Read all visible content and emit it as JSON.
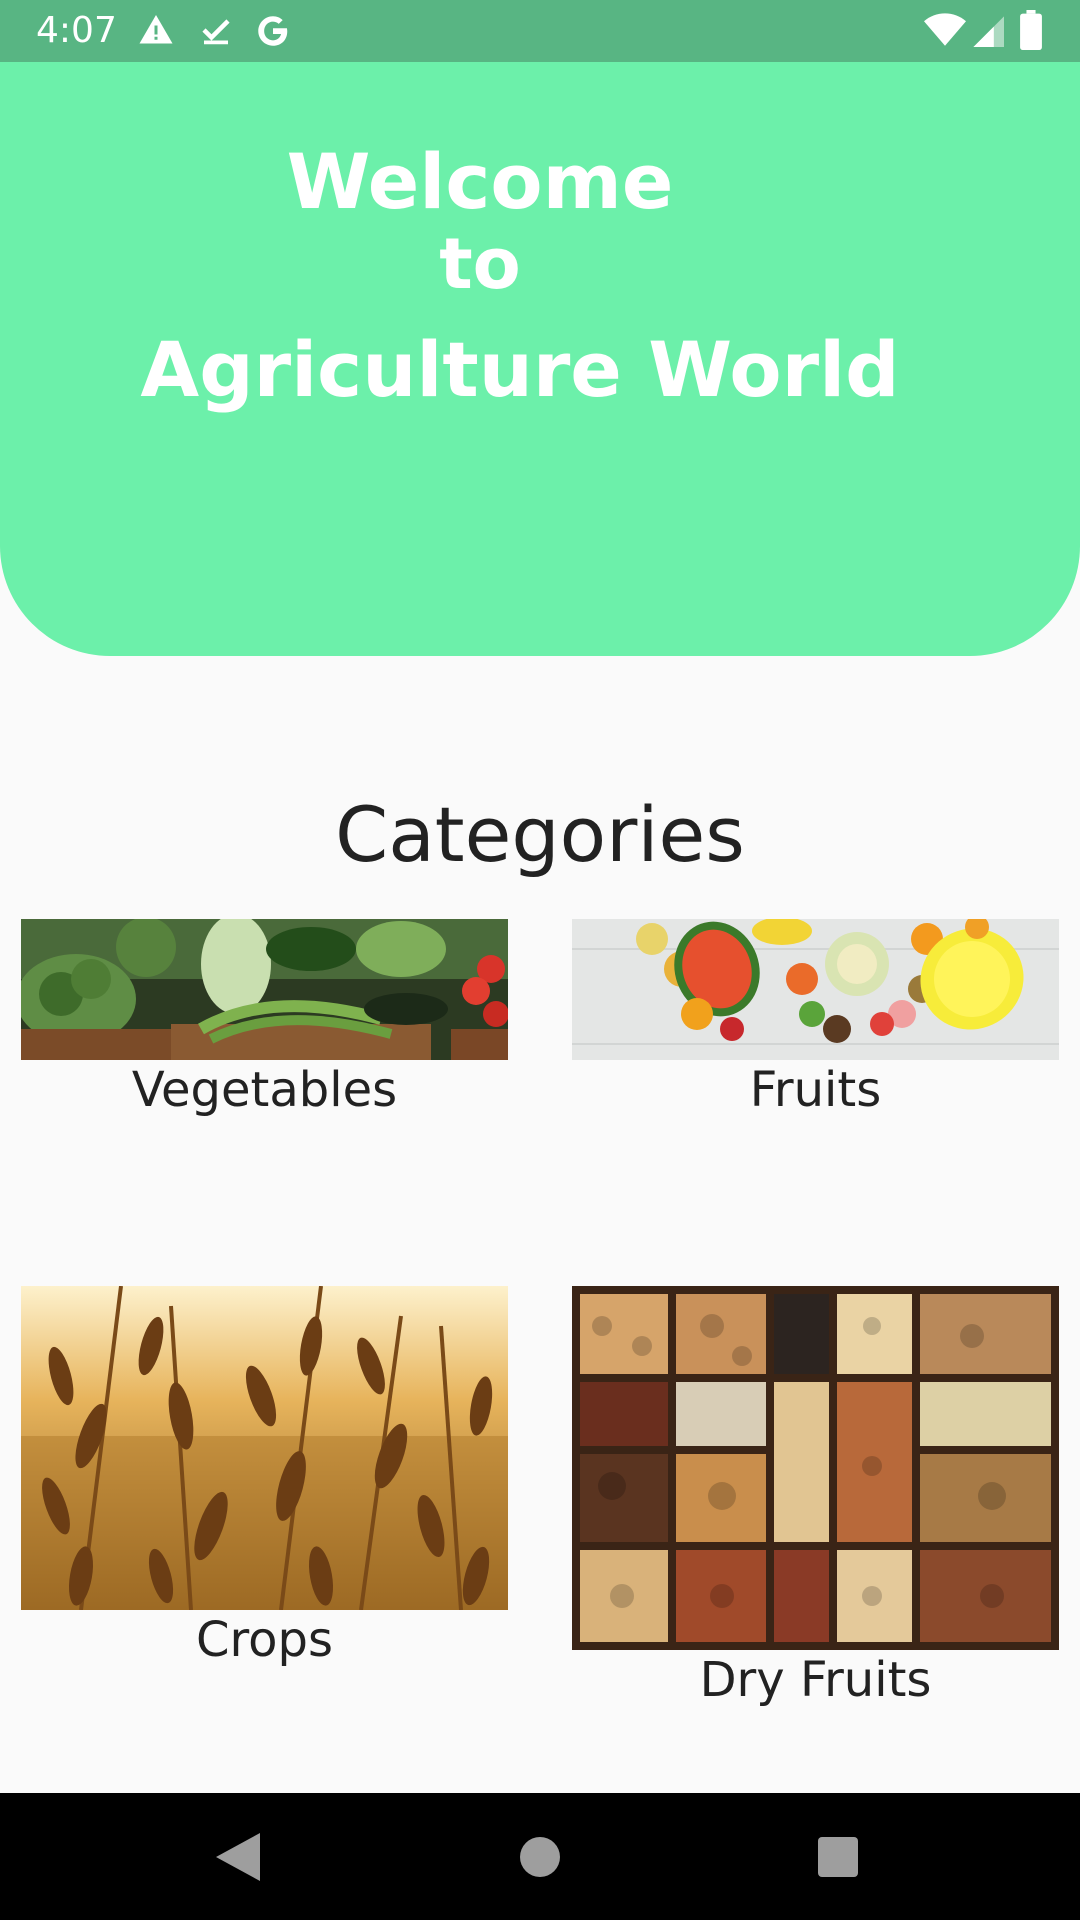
{
  "status_bar": {
    "time": "4:07",
    "left_icons": [
      "warning-icon",
      "download-done-icon",
      "google-icon"
    ],
    "right_icons": [
      "wifi-icon",
      "signal-icon",
      "battery-icon"
    ]
  },
  "header": {
    "line1": "Welcome",
    "line2": "to",
    "line3": "Agriculture World",
    "background": "#6cf0aa"
  },
  "categories": {
    "title": "Categories",
    "items": [
      {
        "label": "Vegetables"
      },
      {
        "label": "Fruits"
      },
      {
        "label": "Crops"
      },
      {
        "label": "Dry Fruits"
      }
    ]
  },
  "nav_bar": {
    "buttons": [
      "back-icon",
      "home-icon",
      "recents-icon"
    ]
  }
}
